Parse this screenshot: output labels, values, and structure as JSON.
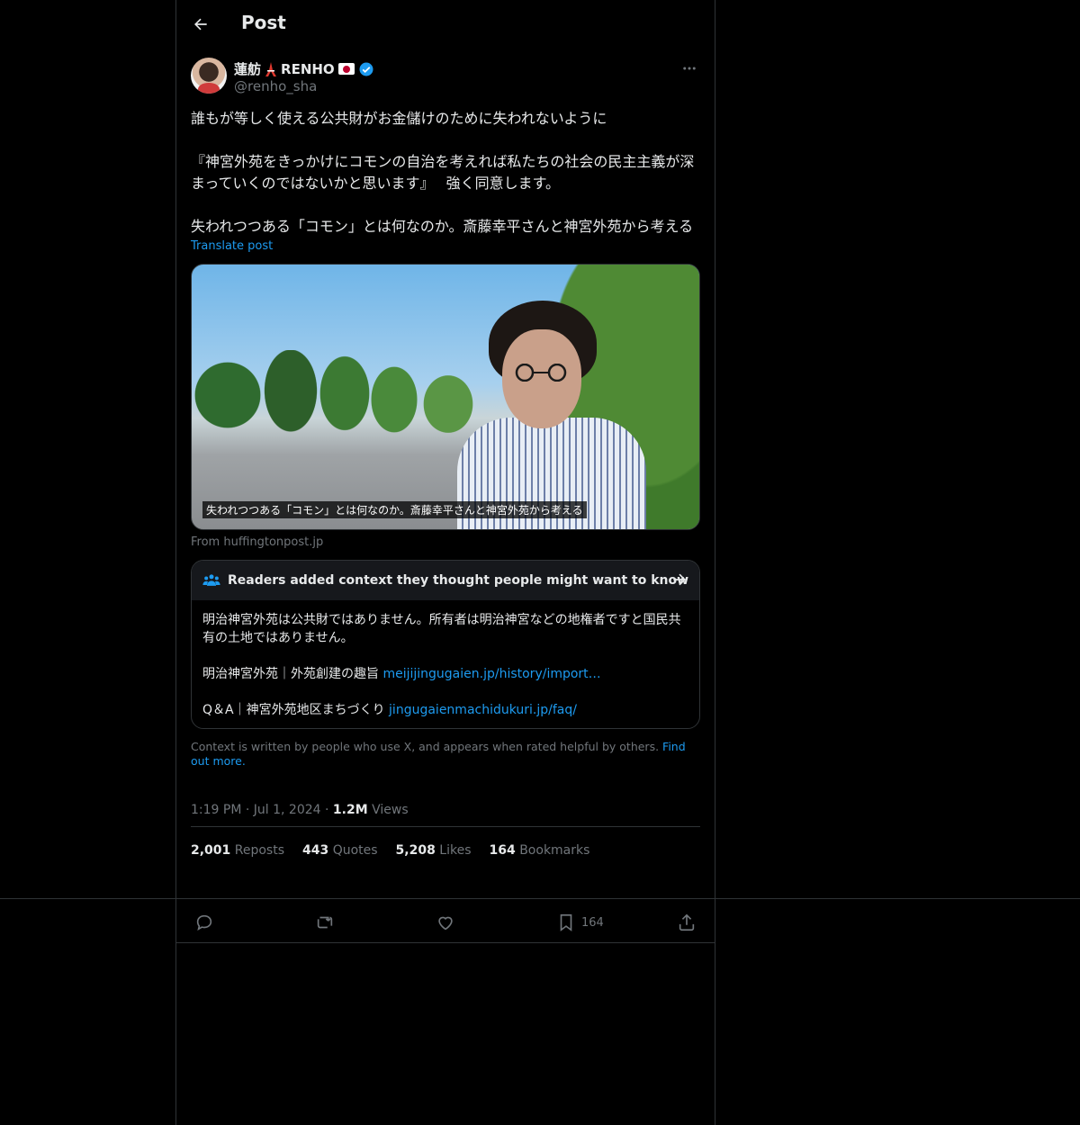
{
  "header": {
    "title": "Post"
  },
  "author": {
    "name": "蓮舫",
    "name_suffix": "RENHO",
    "handle": "@renho_sha",
    "verified": true
  },
  "post": {
    "text": "誰もが等しく使える公共財がお金儲けのために失われないように\n\n『神宮外苑をきっかけにコモンの自治を考えれば私たちの社会の民主主義が深まっていくのではないかと思います』　 強く同意します。\n\n失われつつある「コモン」とは何なのか。斎藤幸平さんと神宮外苑から考える",
    "translate_label": "Translate post"
  },
  "media": {
    "caption": "失われつつある「コモン」とは何なのか。斎藤幸平さんと神宮外苑から考える",
    "source": "From huffingtonpost.jp"
  },
  "note": {
    "title": "Readers added context they thought people might want to know",
    "body": "明治神宮外苑は公共財ではありません。所有者は明治神宮などの地権者ですと国民共有の土地ではありません。",
    "ref1_label": "明治神宮外苑｜外苑創建の趣旨 ",
    "ref1_link": "meijijingugaien.jp/history/import…",
    "ref2_label": "Q＆A｜神宮外苑地区まちづくり ",
    "ref2_link": "jingugaienmachidukuri.jp/faq/"
  },
  "disclaimer": {
    "text": "Context is written by people who use X, and appears when rated helpful by others.",
    "link": "Find out more."
  },
  "meta": {
    "time": "1:19 PM",
    "date": "Jul 1, 2024",
    "views": "1.2M",
    "views_label": "Views"
  },
  "stats": {
    "reposts": "2,001",
    "reposts_label": "Reposts",
    "quotes": "443",
    "quotes_label": "Quotes",
    "likes": "5,208",
    "likes_label": "Likes",
    "bookmarks": "164",
    "bookmarks_label": "Bookmarks"
  },
  "actions": {
    "bookmark_count": "164"
  },
  "colors": {
    "background": "#000000",
    "accent": "#1d9bf0",
    "muted": "#71767b",
    "border": "#2f3336"
  }
}
